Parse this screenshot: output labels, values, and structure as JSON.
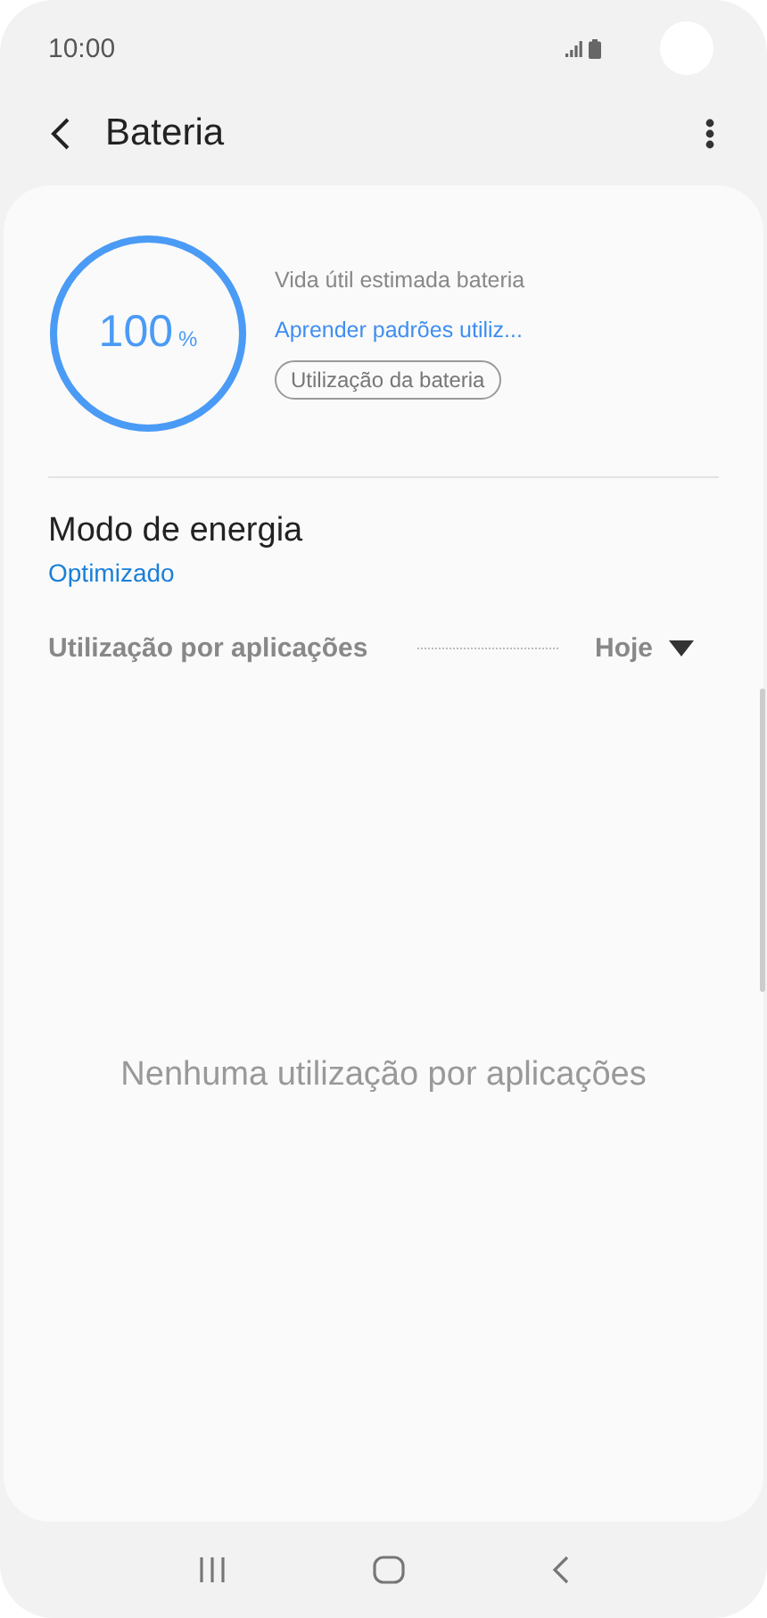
{
  "status_bar": {
    "time": "10:00"
  },
  "toolbar": {
    "title": "Bateria"
  },
  "battery": {
    "percent": "100",
    "unit": "%",
    "level": 1,
    "estimate_label": "Vida útil estimada bateria",
    "link": "Aprender padrões utiliz...",
    "button": "Utilização da bateria"
  },
  "power_mode": {
    "title": "Modo de energia",
    "value": "Optimizado"
  },
  "usage": {
    "title": "Utilização por aplicações",
    "period": "Hoje",
    "empty_message": "Nenhuma utilização por aplicações"
  }
}
